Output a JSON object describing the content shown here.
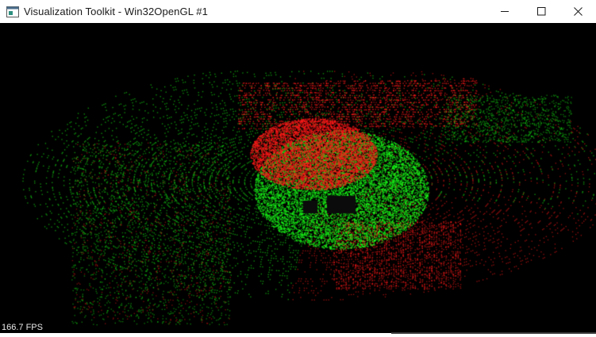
{
  "window": {
    "title": "Visualization Toolkit - Win32OpenGL #1",
    "icon": "vtk-window-icon",
    "controls": [
      "minimize-icon",
      "maximize-icon",
      "close-icon"
    ]
  },
  "viewport": {
    "fps_label": "166.7 FPS",
    "background_color": "#000000",
    "point_clouds": [
      {
        "name": "red",
        "color": "#ff1a1a"
      },
      {
        "name": "green",
        "color": "#19ff19"
      }
    ]
  }
}
